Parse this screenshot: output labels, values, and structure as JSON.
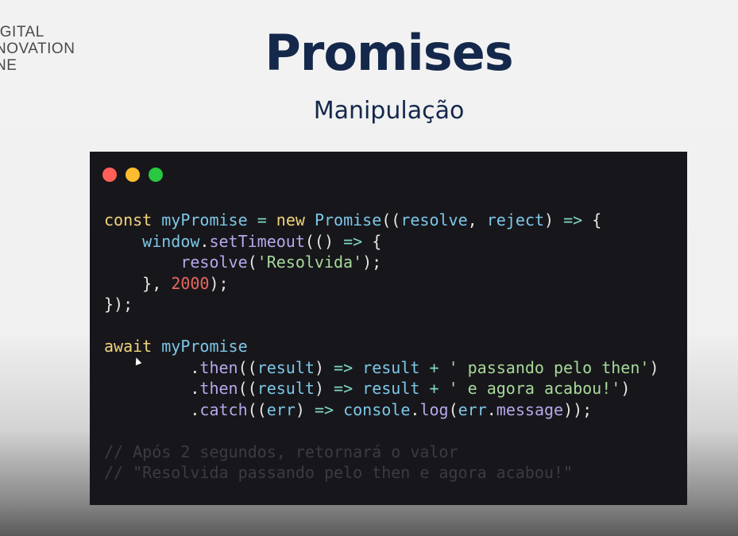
{
  "logo": {
    "line1": "IGITAL",
    "line2": "NOVATION",
    "line3": "NE"
  },
  "slide": {
    "title": "Promises",
    "subtitle": "Manipulação"
  },
  "window_controls": {
    "close_color": "#ff5f57",
    "minimize_color": "#febc2e",
    "maximize_color": "#28c840"
  },
  "code": {
    "l1": {
      "a": "const",
      "b": "myPromise",
      "c": "=",
      "d": "new",
      "e": "Promise",
      "f": "((",
      "g": "resolve",
      "h": ",",
      "i": "reject",
      "j": ")",
      "k": "=>",
      "l": "{"
    },
    "l2": {
      "a": "window",
      "b": ".",
      "c": "setTimeout",
      "d": "(()",
      "e": "=>",
      "f": "{"
    },
    "l3": {
      "a": "resolve",
      "b": "(",
      "c": "'Resolvida'",
      "d": ");"
    },
    "l4": {
      "a": "},",
      "b": "2000",
      "c": ");"
    },
    "l5": {
      "a": "});"
    },
    "l7": {
      "a": "await",
      "b": "myPromise"
    },
    "l8": {
      "a": ".",
      "b": "then",
      "c": "((",
      "d": "result",
      "e": ")",
      "f": "=>",
      "g": "result",
      "h": "+",
      "i": "' passando pelo then'",
      "j": ")"
    },
    "l9": {
      "a": ".",
      "b": "then",
      "c": "((",
      "d": "result",
      "e": ")",
      "f": "=>",
      "g": "result",
      "h": "+",
      "i": "' e agora acabou!'",
      "j": ")"
    },
    "l10": {
      "a": ".",
      "b": "catch",
      "c": "((",
      "d": "err",
      "e": ")",
      "f": "=>",
      "g": "console",
      "h": ".",
      "i": "log",
      "j": "(",
      "k": "err",
      "l": ".",
      "m": "message",
      "n": "));"
    },
    "l12": {
      "a": "// Após 2 segundos, retornará o valor"
    },
    "l13": {
      "a": "// \"Resolvida passando pelo then e agora acabou!\""
    }
  }
}
